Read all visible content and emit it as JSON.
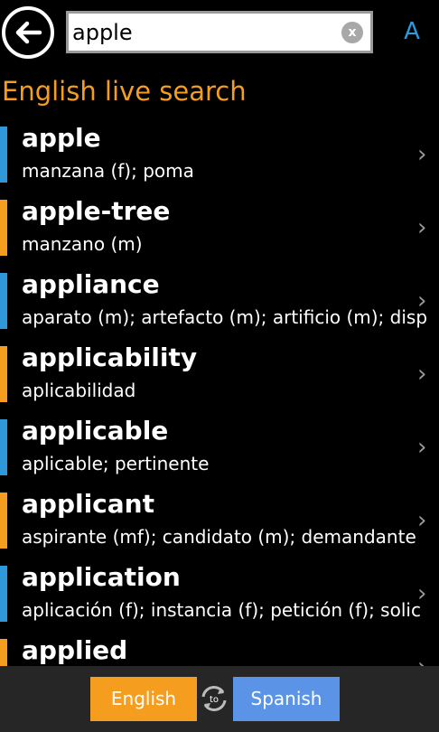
{
  "search": {
    "value": "apple",
    "clear_label": "x",
    "font_label": "A"
  },
  "heading": "English live search",
  "colors": {
    "accent_orange": "#f59d1f",
    "accent_blue": "#2e98d8",
    "spanish_button": "#5b94e6"
  },
  "results": [
    {
      "word": "apple",
      "translation": "manzana (f); poma",
      "bar_color": "#2e98d8"
    },
    {
      "word": "apple-tree",
      "translation": "manzano (m)",
      "bar_color": "#f59d1f"
    },
    {
      "word": "appliance",
      "translation": "aparato (m); artefacto (m); artificio (m); disp",
      "bar_color": "#2e98d8"
    },
    {
      "word": "applicability",
      "translation": "aplicabilidad",
      "bar_color": "#f59d1f"
    },
    {
      "word": "applicable",
      "translation": "aplicable; pertinente",
      "bar_color": "#2e98d8"
    },
    {
      "word": "applicant",
      "translation": "aspirante (mf); candidato (m); demandante",
      "bar_color": "#f59d1f"
    },
    {
      "word": "application",
      "translation": "aplicación (f); instancia (f); petición (f); solic",
      "bar_color": "#2e98d8"
    },
    {
      "word": "applied",
      "translation": "",
      "bar_color": "#f59d1f"
    }
  ],
  "bottom": {
    "from_label": "English",
    "to_label": "Spanish",
    "swap_label": "to"
  }
}
